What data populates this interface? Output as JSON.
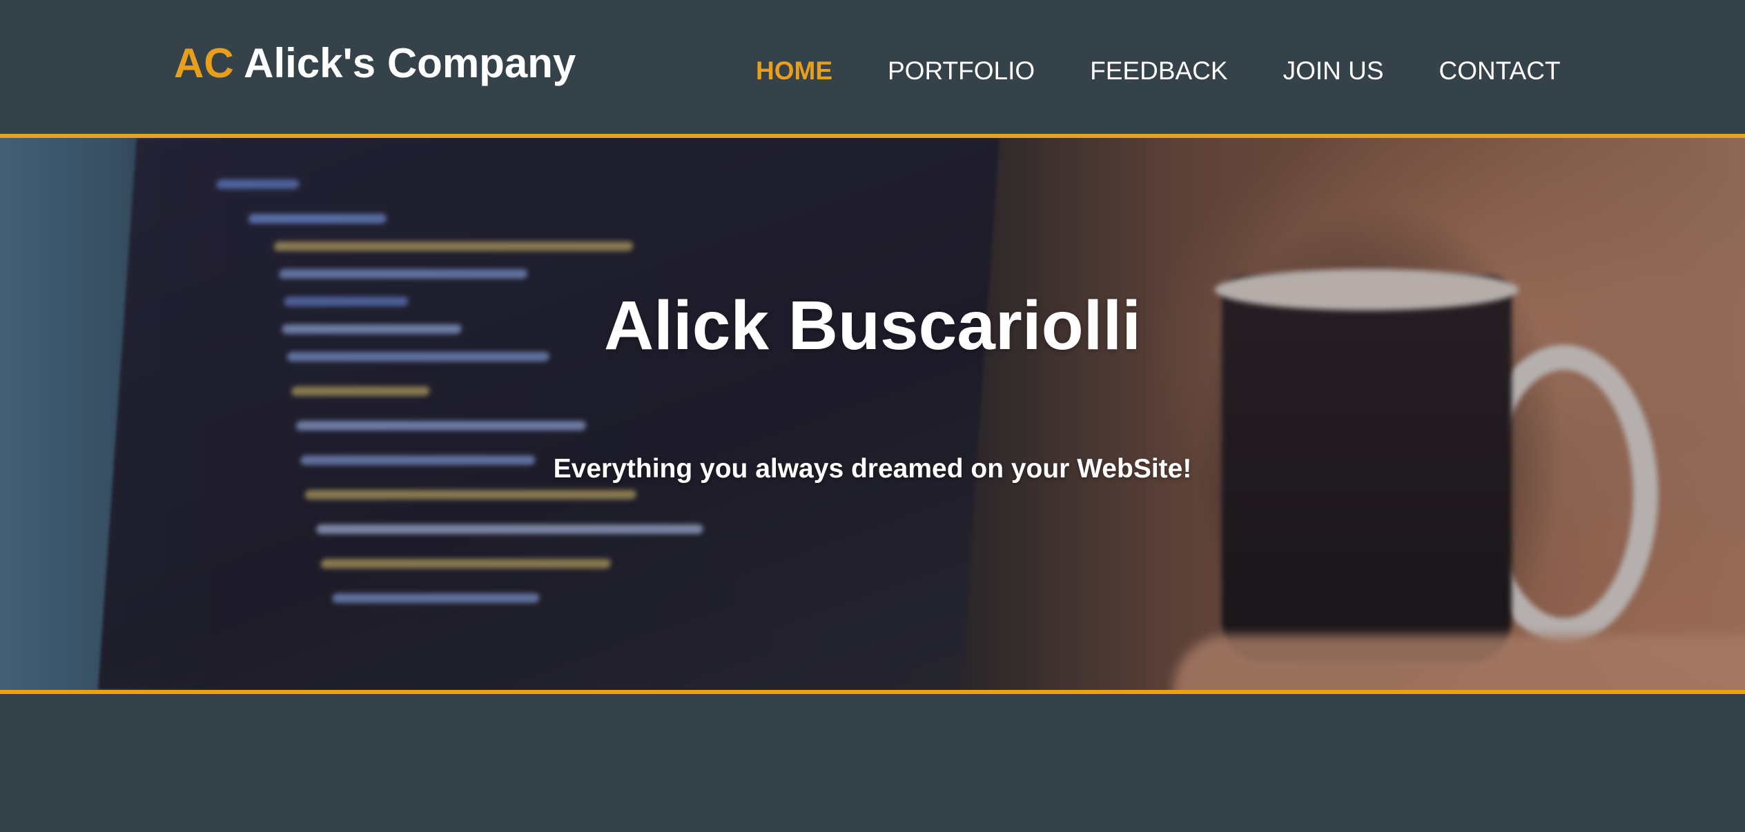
{
  "header": {
    "brand_accent": "AC",
    "brand_name": "Alick's Company",
    "nav": [
      {
        "label": "HOME",
        "active": true
      },
      {
        "label": "PORTFOLIO",
        "active": false
      },
      {
        "label": "FEEDBACK",
        "active": false
      },
      {
        "label": "JOIN US",
        "active": false
      },
      {
        "label": "CONTACT",
        "active": false
      }
    ]
  },
  "hero": {
    "title": "Alick Buscariolli",
    "subtitle": "Everything you always dreamed on your WebSite!"
  },
  "colors": {
    "background": "#35424a",
    "accent": "#e8a01c",
    "text": "#ffffff"
  }
}
